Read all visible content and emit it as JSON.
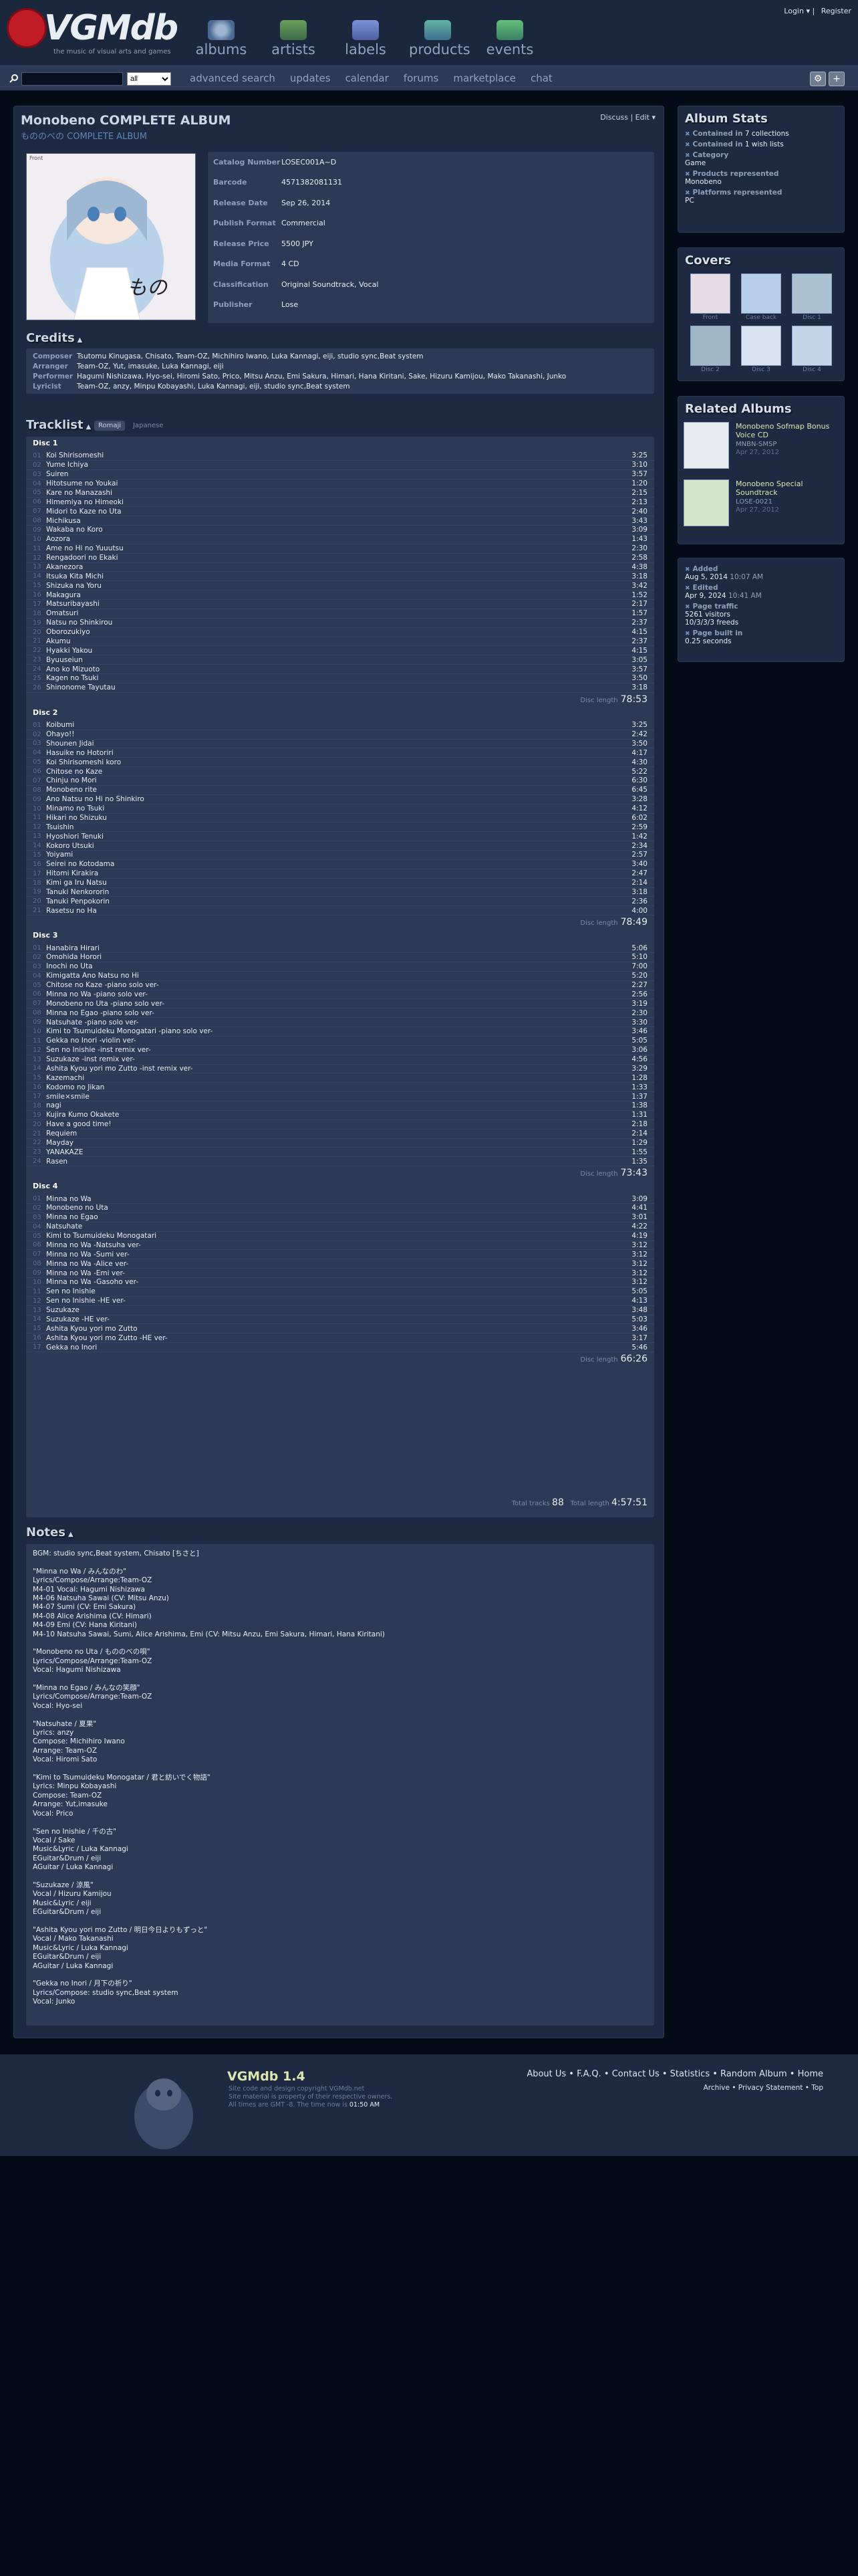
{
  "header": {
    "logo_text": "VGMdb",
    "tagline": "the music of visual arts and games",
    "nav": [
      "albums",
      "artists",
      "labels",
      "products",
      "events"
    ],
    "login": "Login",
    "register": "Register"
  },
  "search": {
    "placeholder": "",
    "select_value": "all",
    "links": [
      "advanced search",
      "updates",
      "calendar",
      "forums",
      "marketplace",
      "chat"
    ]
  },
  "album": {
    "title": "Monobeno COMPLETE ALBUM",
    "subtitle": "もののべの COMPLETE ALBUM",
    "discuss": "Discuss",
    "edit": "Edit",
    "cover_label": "Front",
    "info": [
      {
        "label": "Catalog Number",
        "value": "LOSEC001A~D"
      },
      {
        "label": "Barcode",
        "value": "4571382081131"
      },
      {
        "label": "Release Date",
        "value": "Sep 26, 2014"
      },
      {
        "label": "Publish Format",
        "value": "Commercial"
      },
      {
        "label": "Release Price",
        "value": "5500 JPY"
      },
      {
        "label": "Media Format",
        "value": "4 CD"
      },
      {
        "label": "Classification",
        "value": "Original Soundtrack, Vocal"
      },
      {
        "label": "Publisher",
        "value": "Lose"
      }
    ]
  },
  "credits": {
    "heading": "Credits",
    "rows": [
      {
        "label": "Composer",
        "value": "Tsutomu Kinugasa, Chisato, Team-OZ, Michihiro Iwano, Luka Kannagi, eiji, studio sync,Beat system"
      },
      {
        "label": "Arranger",
        "value": "Team-OZ, Yut, imasuke, Luka Kannagi, eiji"
      },
      {
        "label": "Performer",
        "value": "Hagumi Nishizawa, Hyo-sei, Hiromi Sato, Prico, Mitsu Anzu, Emi Sakura, Himari, Hana Kiritani, Sake, Hizuru Kamijou, Mako Takanashi, Junko"
      },
      {
        "label": "Lyricist",
        "value": "Team-OZ, anzy, Minpu Kobayashi, Luka Kannagi, eiji, studio sync,Beat system"
      }
    ]
  },
  "tracklist": {
    "heading": "Tracklist",
    "tabs": [
      "Romaji",
      "Japanese"
    ],
    "disc_length_label": "Disc length",
    "total_tracks_label": "Total tracks",
    "total_tracks": "88",
    "total_length_label": "Total length",
    "total_length": "4:57:51",
    "discs": [
      {
        "name": "Disc 1",
        "length": "78:53",
        "tracks": [
          [
            "01",
            "Koi Shirisomeshi",
            "3:25"
          ],
          [
            "02",
            "Yume Ichiya",
            "3:10"
          ],
          [
            "03",
            "Suiren",
            "3:57"
          ],
          [
            "04",
            "Hitotsume no Youkai",
            "1:20"
          ],
          [
            "05",
            "Kare no Manazashi",
            "2:15"
          ],
          [
            "06",
            "Himemiya no Himeoki",
            "2:13"
          ],
          [
            "07",
            "Midori to Kaze no Uta",
            "2:40"
          ],
          [
            "08",
            "Michikusa",
            "3:43"
          ],
          [
            "09",
            "Wakaba no Koro",
            "3:09"
          ],
          [
            "10",
            "Aozora",
            "1:43"
          ],
          [
            "11",
            "Ame no Hi no Yuuutsu",
            "2:30"
          ],
          [
            "12",
            "Rengadoori no Ekaki",
            "2:58"
          ],
          [
            "13",
            "Akanezora",
            "4:38"
          ],
          [
            "14",
            "Itsuka Kita Michi",
            "3:18"
          ],
          [
            "15",
            "Shizuka na Yoru",
            "3:42"
          ],
          [
            "16",
            "Makagura",
            "1:52"
          ],
          [
            "17",
            "Matsuribayashi",
            "2:17"
          ],
          [
            "18",
            "Omatsuri",
            "1:57"
          ],
          [
            "19",
            "Natsu no Shinkirou",
            "2:37"
          ],
          [
            "20",
            "Oborozukiyo",
            "4:15"
          ],
          [
            "21",
            "Akumu",
            "2:37"
          ],
          [
            "22",
            "Hyakki Yakou",
            "4:15"
          ],
          [
            "23",
            "Byuuseiun",
            "3:05"
          ],
          [
            "24",
            "Ano ko Mizuoto",
            "3:57"
          ],
          [
            "25",
            "Kagen no Tsuki",
            "3:50"
          ],
          [
            "26",
            "Shinonome Tayutau",
            "3:18"
          ]
        ]
      },
      {
        "name": "Disc 2",
        "length": "78:49",
        "tracks": [
          [
            "01",
            "Koibumi",
            "3:25"
          ],
          [
            "02",
            "Ohayo!!",
            "2:42"
          ],
          [
            "03",
            "Shounen Jidai",
            "3:50"
          ],
          [
            "04",
            "Hasuike no Hotoriri",
            "4:17"
          ],
          [
            "05",
            "Koi Shirisomeshi koro",
            "4:30"
          ],
          [
            "06",
            "Chitose no Kaze",
            "5:22"
          ],
          [
            "07",
            "Chinju no Mori",
            "6:30"
          ],
          [
            "08",
            "Monobeno rite",
            "6:45"
          ],
          [
            "09",
            "Ano Natsu no Hi no Shinkiro",
            "3:28"
          ],
          [
            "10",
            "Minamo no Tsuki",
            "4:12"
          ],
          [
            "11",
            "Hikari no Shizuku",
            "6:02"
          ],
          [
            "12",
            "Tsuishin",
            "2:59"
          ],
          [
            "13",
            "Hyoshiori Tenuki",
            "1:42"
          ],
          [
            "14",
            "Kokoro Utsuki",
            "2:34"
          ],
          [
            "15",
            "Yoiyami",
            "2:57"
          ],
          [
            "16",
            "Seirei no Kotodama",
            "3:40"
          ],
          [
            "17",
            "Hitomi Kirakira",
            "2:47"
          ],
          [
            "18",
            "Kimi ga Iru Natsu",
            "2:14"
          ],
          [
            "19",
            "Tanuki Nenkororin",
            "3:18"
          ],
          [
            "20",
            "Tanuki Penpokorin",
            "2:36"
          ],
          [
            "21",
            "Rasetsu no Ha",
            "4:00"
          ]
        ]
      },
      {
        "name": "Disc 3",
        "length": "73:43",
        "tracks": [
          [
            "01",
            "Hanabira Hirari",
            "5:06"
          ],
          [
            "02",
            "Omohida Horori",
            "5:10"
          ],
          [
            "03",
            "Inochi no Uta",
            "7:00"
          ],
          [
            "04",
            "Kimigatta Ano Natsu no Hi",
            "5:20"
          ],
          [
            "05",
            "Chitose no Kaze -piano solo ver-",
            "2:27"
          ],
          [
            "06",
            "Minna no Wa -piano solo ver-",
            "2:56"
          ],
          [
            "07",
            "Monobeno no Uta -piano solo ver-",
            "3:19"
          ],
          [
            "08",
            "Minna no Egao -piano solo ver-",
            "2:30"
          ],
          [
            "09",
            "Natsuhate -piano solo ver-",
            "3:30"
          ],
          [
            "10",
            "Kimi to Tsumuideku Monogatari -piano solo ver-",
            "3:46"
          ],
          [
            "11",
            "Gekka no Inori -violin ver-",
            "5:05"
          ],
          [
            "12",
            "Sen no Inishie -inst remix ver-",
            "3:06"
          ],
          [
            "13",
            "Suzukaze -inst remix ver-",
            "4:56"
          ],
          [
            "14",
            "Ashita Kyou yori mo Zutto -inst remix ver-",
            "3:29"
          ],
          [
            "15",
            "Kazemachi",
            "1:28"
          ],
          [
            "16",
            "Kodomo no Jikan",
            "1:33"
          ],
          [
            "17",
            "smile×smile",
            "1:37"
          ],
          [
            "18",
            "nagi",
            "1:38"
          ],
          [
            "19",
            "Kujira Kumo Okakete",
            "1:31"
          ],
          [
            "20",
            "Have a good time!",
            "2:18"
          ],
          [
            "21",
            "Requiem",
            "2:14"
          ],
          [
            "22",
            "Mayday",
            "1:29"
          ],
          [
            "23",
            "YANAKAZE",
            "1:55"
          ],
          [
            "24",
            "Rasen",
            "1:35"
          ]
        ]
      },
      {
        "name": "Disc 4",
        "length": "66:26",
        "tracks": [
          [
            "01",
            "Minna no Wa",
            "3:09"
          ],
          [
            "02",
            "Monobeno no Uta",
            "4:41"
          ],
          [
            "03",
            "Minna no Egao",
            "3:01"
          ],
          [
            "04",
            "Natsuhate",
            "4:22"
          ],
          [
            "05",
            "Kimi to Tsumuideku Monogatari",
            "4:19"
          ],
          [
            "06",
            "Minna no Wa -Natsuha ver-",
            "3:12"
          ],
          [
            "07",
            "Minna no Wa -Sumi ver-",
            "3:12"
          ],
          [
            "08",
            "Minna no Wa -Alice ver-",
            "3:12"
          ],
          [
            "09",
            "Minna no Wa -Emi ver-",
            "3:12"
          ],
          [
            "10",
            "Minna no Wa -Gasoho ver-",
            "3:12"
          ],
          [
            "11",
            "Sen no Inishie",
            "5:05"
          ],
          [
            "12",
            "Sen no Inishie -HE ver-",
            "4:13"
          ],
          [
            "13",
            "Suzukaze",
            "3:48"
          ],
          [
            "14",
            "Suzukaze -HE ver-",
            "5:03"
          ],
          [
            "15",
            "Ashita Kyou yori mo Zutto",
            "3:46"
          ],
          [
            "16",
            "Ashita Kyou yori mo Zutto -HE ver-",
            "3:17"
          ],
          [
            "17",
            "Gekka no Inori",
            "5:46"
          ]
        ]
      }
    ]
  },
  "notes": {
    "heading": "Notes",
    "lines": [
      "BGM: studio sync,Beat system, Chisato [ちさと]",
      "",
      "\"Minna no Wa / みんなのわ\"",
      "Lyrics/Compose/Arrange:Team-OZ",
      "M4-01 Vocal: Hagumi Nishizawa",
      "M4-06 Natsuha Sawai (CV: Mitsu Anzu)",
      "M4-07 Sumi (CV: Emi Sakura)",
      "M4-08 Alice Arishima (CV: Himari)",
      "M4-09 Emi (CV: Hana Kiritani)",
      "M4-10 Natsuha Sawai, Sumi, Alice Arishima, Emi (CV: Mitsu Anzu, Emi Sakura, Himari, Hana Kiritani)",
      "",
      "\"Monobeno no Uta / もののべの唄\"",
      "Lyrics/Compose/Arrange:Team-OZ",
      "Vocal: Hagumi Nishizawa",
      "",
      "\"Minna no Egao / みんなの笑顔\"",
      "Lyrics/Compose/Arrange:Team-OZ",
      "Vocal: Hyo-sei",
      "",
      "\"Natsuhate / 夏果\"",
      "Lyrics: anzy",
      "Compose: Michihiro Iwano",
      "Arrange: Team-OZ",
      "Vocal: Hiromi Sato",
      "",
      "\"Kimi to Tsumuideku Monogatar / 君と紡いでく物語\"",
      "Lyrics: Minpu Kobayashi",
      "Compose: Team-OZ",
      "Arrange: Yut,imasuke",
      "Vocal: Prico",
      "",
      "\"Sen no Inishie / 千の古\"",
      "Vocal / Sake",
      "Music&Lyric / Luka Kannagi",
      "EGuitar&Drum / eiji",
      "AGuitar / Luka Kannagi",
      "",
      "\"Suzukaze / 涼風\"",
      "Vocal / Hizuru Kamijou",
      "Music&Lyric / eiji",
      "EGuitar&Drum / eiji",
      "",
      "\"Ashita Kyou yori mo Zutto / 明日今日よりもずっと\"",
      "Vocal / Mako Takanashi",
      "Music&Lyric / Luka Kannagi",
      "EGuitar&Drum / eiji",
      "AGuitar / Luka Kannagi",
      "",
      "\"Gekka no Inori / 月下の祈り\"",
      "Lyrics/Compose: studio sync,Beat system",
      "Vocal: Junko"
    ]
  },
  "stats": {
    "heading": "Album Stats",
    "items": [
      {
        "label": "Contained in",
        "value": "7 collections"
      },
      {
        "label": "Contained in",
        "value": "1 wish lists"
      },
      {
        "label": "Category",
        "value": "Game"
      },
      {
        "label": "Products represented",
        "value": "Monobeno"
      },
      {
        "label": "Platforms represented",
        "value": "PC"
      }
    ]
  },
  "covers": {
    "heading": "Covers",
    "items": [
      "Front",
      "Case back",
      "Disc 1",
      "Disc 2",
      "Disc 3",
      "Disc 4"
    ]
  },
  "related": {
    "heading": "Related Albums",
    "items": [
      {
        "name": "Monobeno Sofmap Bonus Voice CD",
        "catalog": "MNBN-SMSP",
        "date": "Apr 27, 2012"
      },
      {
        "name": "Monobeno Special Soundtrack",
        "catalog": "LOSE-0021",
        "date": "Apr 27, 2012"
      }
    ]
  },
  "meta": {
    "added_label": "Added",
    "added": "Aug 5, 2014",
    "added_time": "10:07 AM",
    "edited_label": "Edited",
    "edited": "Apr 9, 2024",
    "edited_time": "10:41 AM",
    "traffic_label": "Page traffic",
    "visitors": "5261",
    "visitors_label": "visitors",
    "freeds": "10/3/3/3",
    "freeds_label": "freeds",
    "built_label": "Page built in",
    "built": "0.25",
    "built_unit": "seconds"
  },
  "footer": {
    "title": "VGMdb 1.4",
    "line1": "Site code and design copyright VGMdb.net",
    "line2": "Site material is property of their respective owners.",
    "line3_pre": "All times are GMT -8. The time now is",
    "time": "01:50 AM",
    "links": [
      "About Us",
      "F.A.Q.",
      "Contact Us",
      "Statistics",
      "Random Album",
      "Home"
    ],
    "links2": [
      "Archive",
      "Privacy Statement",
      "Top"
    ]
  },
  "colors": {
    "bg": "#020b16",
    "panel": "#1d2a42",
    "inner": "#2c3a56",
    "accent": "#dce6ad",
    "logo_red": "#c01c28"
  }
}
